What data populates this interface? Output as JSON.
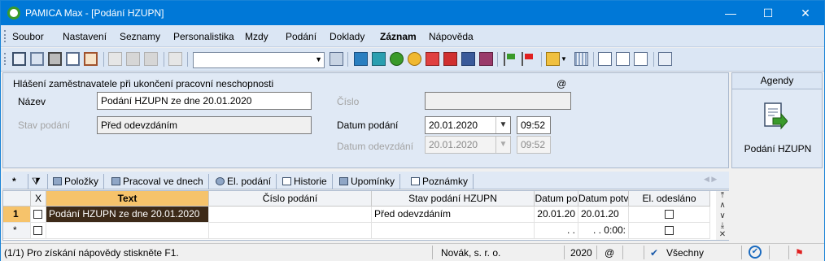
{
  "window": {
    "title": "PAMICA Max - [Podání HZUPN]",
    "minimize": "—",
    "maximize": "☐",
    "close": "✕"
  },
  "menu": [
    "Soubor",
    "Nastavení",
    "Seznamy",
    "Personalistika",
    "Mzdy",
    "Podání",
    "Doklady",
    "Záznam",
    "Nápověda"
  ],
  "toolbar": {
    "combo_value": ""
  },
  "form": {
    "header": "Hlášení zaměstnavatele při ukončení pracovní neschopnosti",
    "at_symbol": "@",
    "nazev_label": "Název",
    "nazev_value": "Podání HZUPN ze dne 20.01.2020",
    "cislo_label": "Číslo",
    "cislo_value": "",
    "stav_label": "Stav podání",
    "stav_value": "Před odevzdáním",
    "datum_podani_label": "Datum podání",
    "datum_podani_value": "20.01.2020",
    "cas_podani_value": "09:52",
    "datum_odevzdani_label": "Datum odevzdání",
    "datum_odevzdani_value": "20.01.2020",
    "cas_odevzdani_value": "09:52"
  },
  "agendy": {
    "title": "Agendy",
    "item": "Podání HZUPN"
  },
  "tabs": {
    "star": "*",
    "items": [
      "Položky",
      "Pracoval ve dnech",
      "El. podání",
      "Historie",
      "Upomínky",
      "Poznámky"
    ]
  },
  "grid": {
    "headers": {
      "x": "X",
      "text": "Text",
      "cislo": "Číslo podání",
      "stav": "Stav podání HZUPN",
      "datum_po": "Datum po",
      "datum_pot": "Datum potv",
      "el": "El. odesláno"
    },
    "row1": {
      "num": "1",
      "text": "Podání HZUPN ze dne 20.01.2020",
      "stav": "Před odevzdáním",
      "datum_po": "20.01.20",
      "datum_pot": "20.01.20"
    },
    "row2": {
      "num": "*",
      "datum_po": ". .",
      "datum_pot": ". . 0:00:"
    }
  },
  "status": {
    "help": "(1/1) Pro získání nápovědy stiskněte F1.",
    "company": "Novák, s. r. o.",
    "year": "2020",
    "at": "@",
    "filter": "Všechny"
  }
}
